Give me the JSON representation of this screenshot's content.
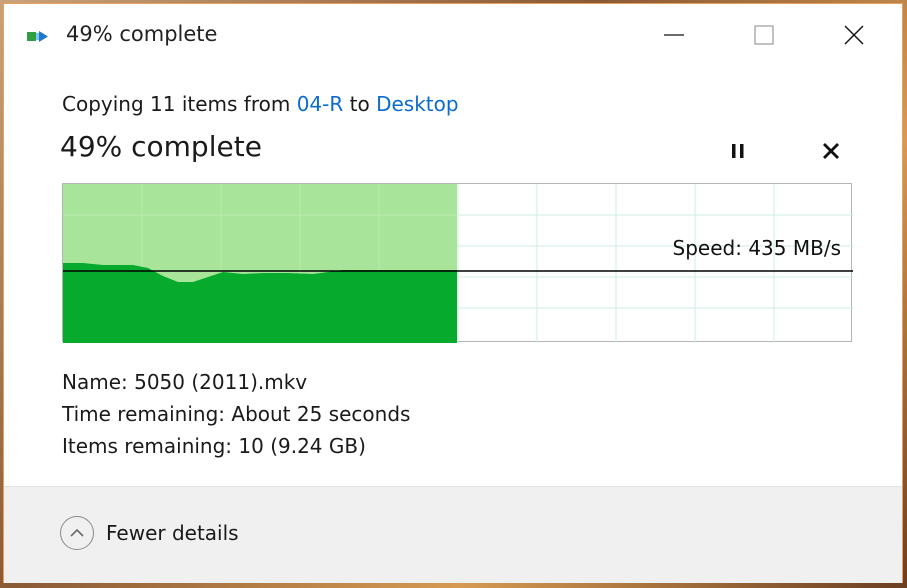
{
  "window": {
    "title": "49% complete",
    "icon": "copy-progress-icon"
  },
  "caption_buttons": {
    "minimize": "minimize-icon",
    "maximize": "maximize-icon",
    "close": "close-icon"
  },
  "copy": {
    "prefix": "Copying 11 items from",
    "source": "04-R",
    "to_word": "to",
    "destination": "Desktop"
  },
  "progress": {
    "heading": "49% complete",
    "percent": 49,
    "pause_icon": "pause-icon",
    "cancel_icon": "cancel-icon"
  },
  "graph": {
    "speed_label": "Speed: 435 MB/s",
    "colors": {
      "completed": "#a8e49a",
      "speed_area": "#06ab2d",
      "grid": "#cfeedd",
      "line": "#000000"
    }
  },
  "details": {
    "name_label": "Name:",
    "name_value": "5050 (2011).mkv",
    "time_label": "Time remaining:",
    "time_value": "About 25 seconds",
    "items_label": "Items remaining:",
    "items_value": "10 (9.24 GB)"
  },
  "footer": {
    "toggle_label": "Fewer details",
    "toggle_icon": "chevron-up-icon"
  }
}
